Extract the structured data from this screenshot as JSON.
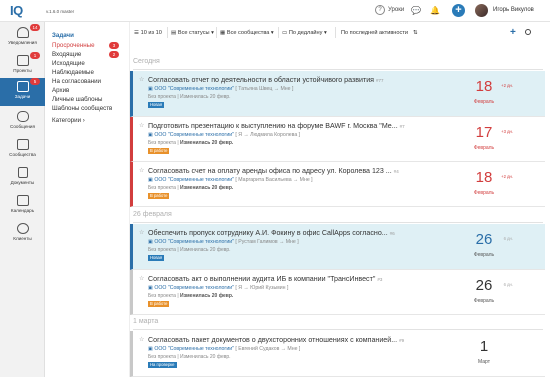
{
  "header": {
    "logo": "IQ",
    "version": "v.1.6.0 master",
    "help_label": "Уроки",
    "user_name": "Игорь Викулов"
  },
  "sidebar": {
    "items": [
      {
        "label": "Уведомления",
        "badge": "14",
        "icon": "bell-icon"
      },
      {
        "label": "Проекты",
        "badge": "1",
        "icon": "folder-icon"
      },
      {
        "label": "Задачи",
        "badge": "5",
        "icon": "tasks-icon",
        "active": true
      },
      {
        "label": "Сообщения",
        "badge": "",
        "icon": "chat-icon"
      },
      {
        "label": "Сообщества",
        "badge": "",
        "icon": "community-icon"
      },
      {
        "label": "Документы",
        "badge": "",
        "icon": "document-icon"
      },
      {
        "label": "Календарь",
        "badge": "",
        "icon": "calendar-icon"
      },
      {
        "label": "Клиенты",
        "badge": "",
        "icon": "clients-icon"
      }
    ]
  },
  "subnav": {
    "title": "Задачи",
    "items": [
      {
        "label": "Просроченные",
        "badge": "3",
        "red": true
      },
      {
        "label": "Входящие",
        "badge": "2",
        "red": false
      },
      {
        "label": "Исходящие",
        "badge": "",
        "red": false
      },
      {
        "label": "Наблюдаемые",
        "badge": "",
        "red": false
      },
      {
        "label": "На согласовании",
        "badge": "",
        "red": false
      },
      {
        "label": "Архив",
        "badge": "",
        "red": false
      },
      {
        "label": "Личные шаблоны",
        "badge": "",
        "red": false
      },
      {
        "label": "Шаблоны сообществ",
        "badge": "",
        "red": false
      },
      {
        "label": "Категории ›",
        "badge": "",
        "red": false
      }
    ]
  },
  "filters": {
    "count": "10 из 10",
    "statuses": "Все статусы ▾",
    "communities": "Все сообщества ▾",
    "deadline": "По дедлайну ▾",
    "activity": "По последней активности"
  },
  "sections": [
    {
      "label": "Сегодня"
    },
    {
      "label": "26 февраля"
    },
    {
      "label": "1 марта"
    }
  ],
  "tasks": [
    {
      "title": "Согласовать отчет по деятельности в области устойчивого развития",
      "number": "#77",
      "company": "ООО \"Современные технологии\"",
      "route": "[ Татьяна Швец → Мне ]",
      "meta_label": "Без проекта",
      "meta_change": "Изменилась 20 февр.",
      "status": "Новая",
      "status_color": "#2a7bb8",
      "day": "18",
      "day_extra": "+2 дн.",
      "month": "Февраль"
    },
    {
      "title": "Подготовить презентацию к выступлению на форуме BAWF г. Москва \"Ме...",
      "number": "#7",
      "company": "ООО \"Современные технологии\"",
      "route": "[ Я → Людмила Королева ]",
      "meta_label": "Без проекта",
      "meta_change": "Изменилась 20 февр.",
      "status": "В работе",
      "status_color": "#e8912b",
      "day": "17",
      "day_extra": "+3 дн.",
      "month": "Февраль"
    },
    {
      "title": "Согласовать счет на оплату аренды офиса по адресу ул. Королева 123 ...",
      "number": "#4",
      "company": "ООО \"Современные технологии\"",
      "route": "[ Маргарита Васильева → Мне ]",
      "meta_label": "Без проекта",
      "meta_change": "Изменилась 20 февр.",
      "status": "В работе",
      "status_color": "#e8912b",
      "day": "18",
      "day_extra": "+2 дн.",
      "month": "Февраль"
    },
    {
      "title": "Обеспечить пропуск сотруднику А.И. Фокину в офис CallApps согласно...",
      "number": "#6",
      "company": "ООО \"Современные технологии\"",
      "route": "[ Рустам Галимов → Мне ]",
      "meta_label": "Без проекта",
      "meta_change": "Изменилась 20 февр.",
      "status": "Новая",
      "status_color": "#2a7bb8",
      "day": "26",
      "day_extra": "6 дн.",
      "month": "Февраль"
    },
    {
      "title": "Согласовать акт о выполнении аудита ИБ в компании \"ТрансИнвест\"",
      "number": "#3",
      "company": "ООО \"Современные технологии\"",
      "route": "[ Я → Юрий Кузьмин ]",
      "meta_label": "Без проекта",
      "meta_change": "Изменилась 20 февр.",
      "status": "В работе",
      "status_color": "#e8912b",
      "day": "26",
      "day_extra": "6 дн.",
      "month": "Февраль"
    },
    {
      "title": "Согласовать пакет документов о двухсторонних отношениях с компанией...",
      "number": "#9",
      "company": "ООО \"Современные технологии\"",
      "route": "[ Евгений Судаков → Мне ]",
      "meta_label": "Без проекта",
      "meta_change": "Изменилась 20 февр.",
      "status": "На проверке",
      "status_color": "#2a7bb8",
      "day": "1",
      "day_extra": "",
      "month": "Март"
    }
  ],
  "colors": {
    "brand": "#2a6ea8",
    "danger": "#d23d3d",
    "highlight": "#dff0f5"
  }
}
